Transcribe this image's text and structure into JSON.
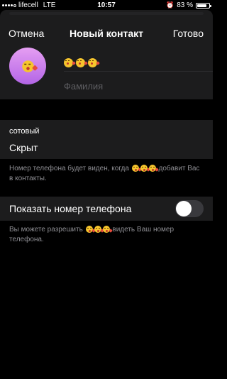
{
  "status_bar": {
    "carrier": "lifecell",
    "network": "LTE",
    "time": "10:57",
    "battery_text": "83 %",
    "battery_level": 0.83,
    "signal_bars_filled": 4,
    "signal_bars_total": 5
  },
  "nav": {
    "cancel_label": "Отмена",
    "title": "Новый контакт",
    "done_label": "Готово"
  },
  "profile": {
    "avatar_icon": "kissing-face-emoji",
    "avatar_color_top": "#e59ef2",
    "avatar_color_bottom": "#b365e6",
    "first_name_emojis": [
      "kissing-face-emoji",
      "kissing-face-emoji",
      "kissing-face-emoji"
    ],
    "last_name_placeholder": "Фамилия"
  },
  "phone": {
    "label": "сотовый",
    "value": "Скрыт",
    "note_before": "Номер телефона будет виден, когда",
    "note_emojis": [
      "kissing-face-emoji",
      "kissing-face-emoji",
      "kissing-face-emoji"
    ],
    "note_after": "добавит Вас в контакты."
  },
  "share_phone": {
    "label": "Показать номер телефона",
    "enabled": false,
    "note_before": "Вы можете разрешить",
    "note_emojis": [
      "kissing-face-emoji",
      "kissing-face-emoji",
      "kissing-face-emoji"
    ],
    "note_after": "видеть Ваш номер телефона."
  }
}
